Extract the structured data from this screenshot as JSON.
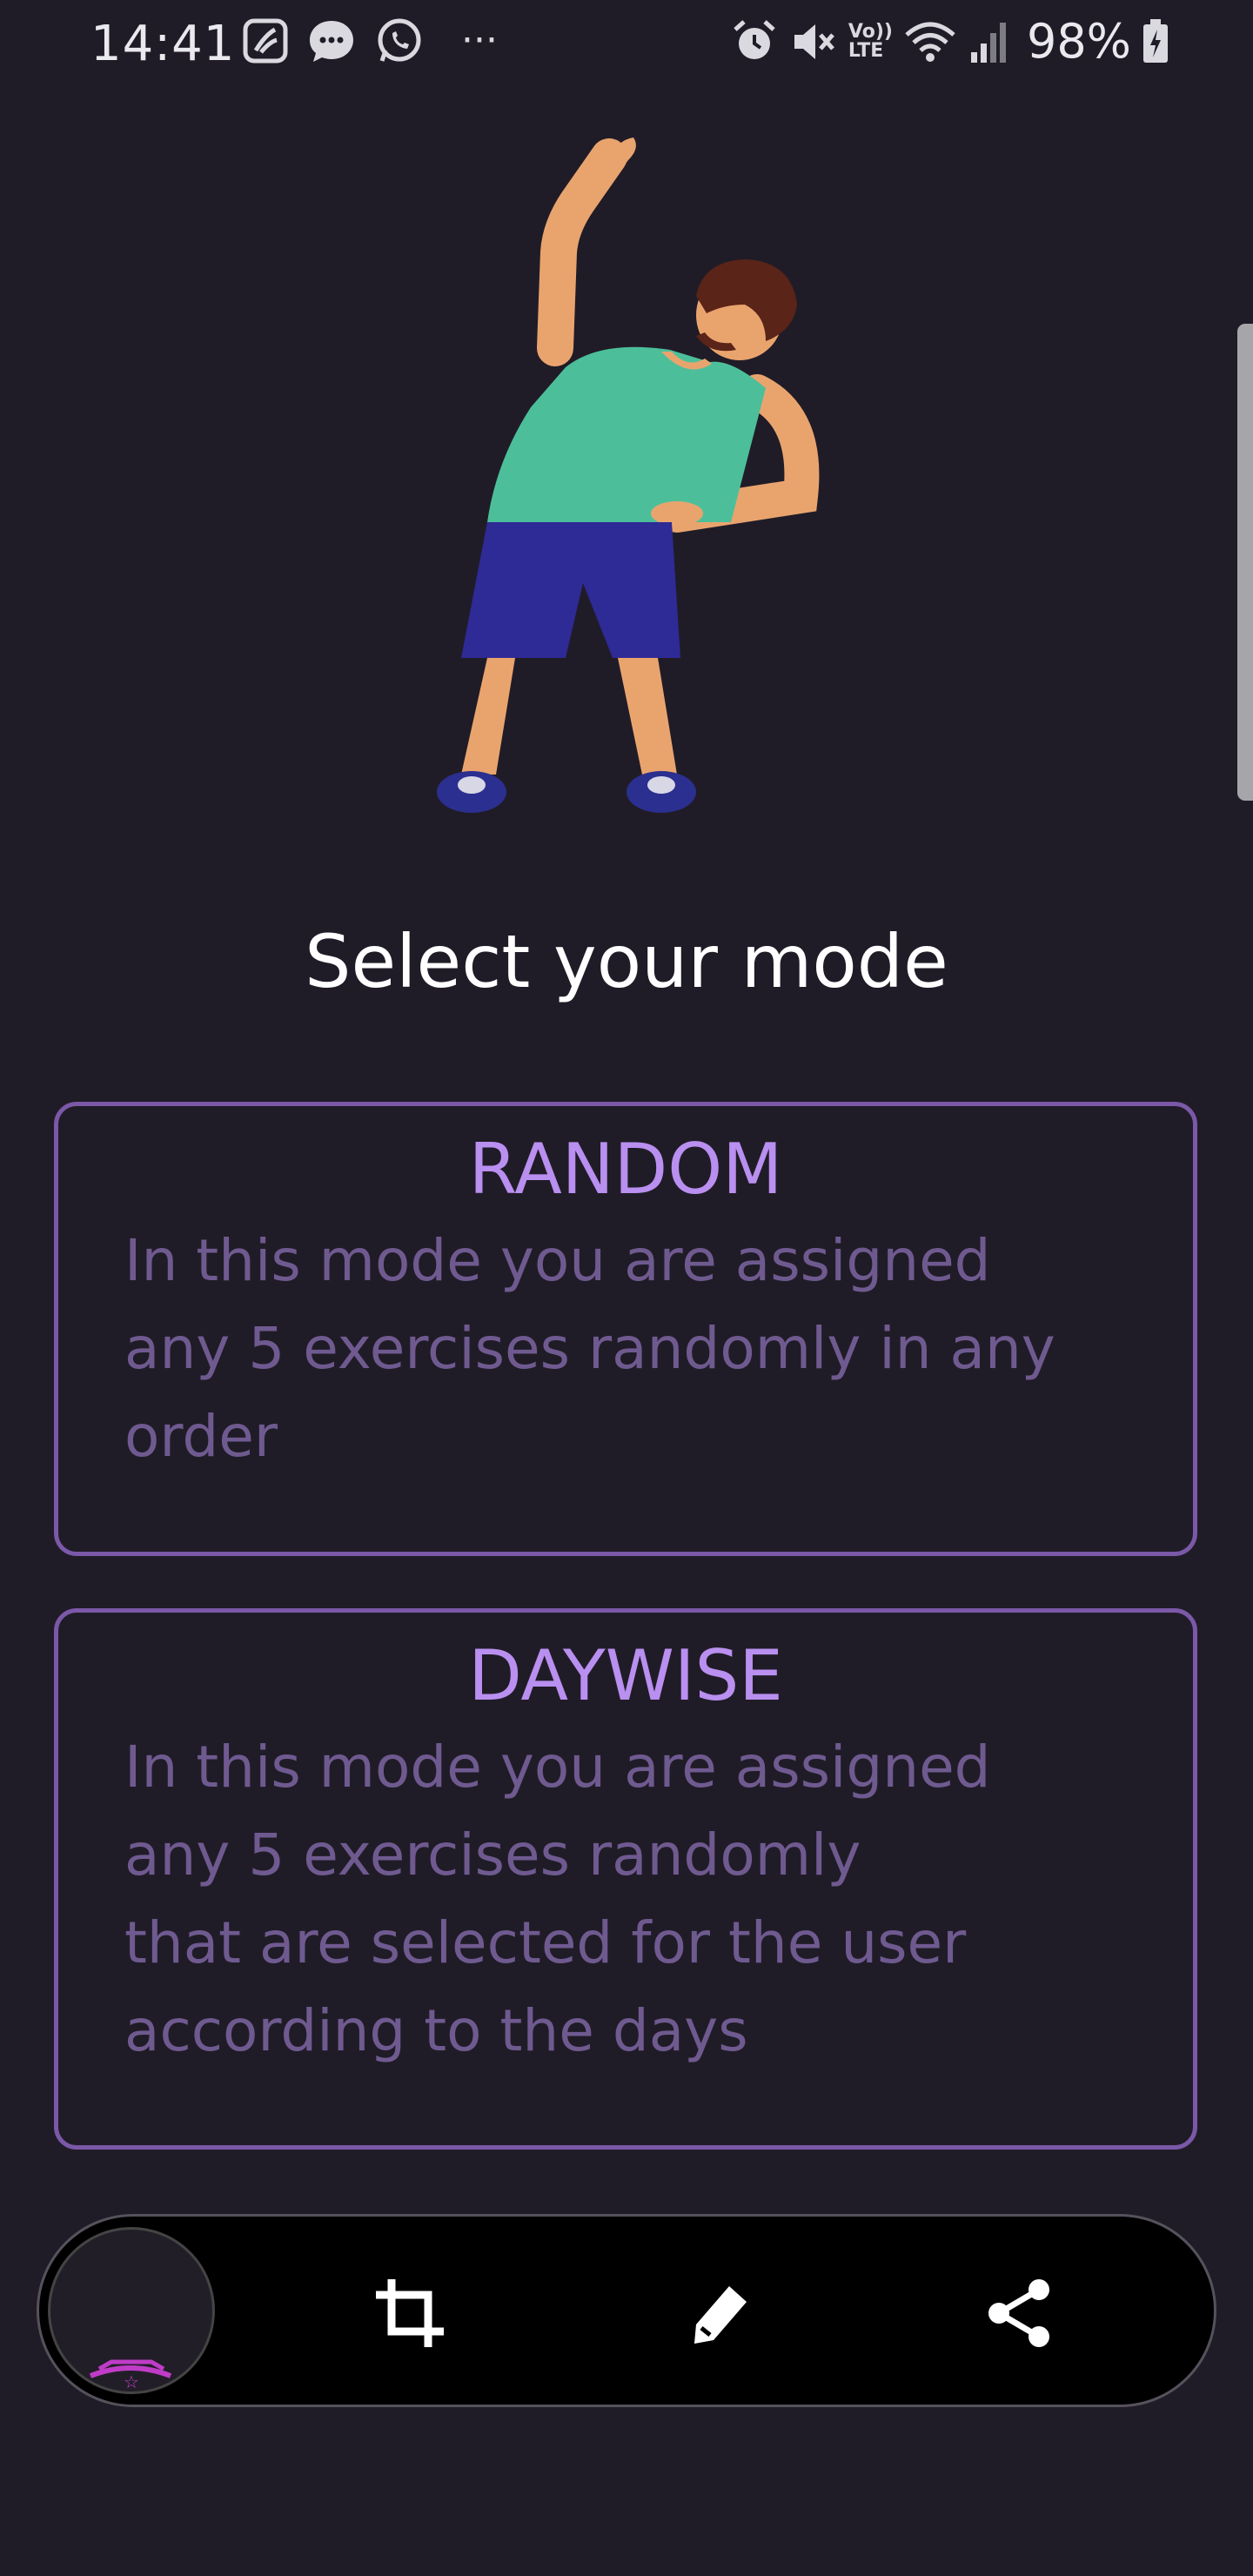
{
  "status_bar": {
    "time": "14:41",
    "battery": "98%",
    "left_icons": [
      "jiosaavn-icon",
      "messages-icon",
      "whatsapp-icon",
      "more-dots-icon"
    ],
    "right_icons": [
      "alarm-icon",
      "mute-icon",
      "volte-icon",
      "wifi-icon",
      "signal-icon",
      "battery-icon"
    ],
    "volte_label_top": "Vo))",
    "volte_label_bottom": "LTE",
    "more": "···"
  },
  "hero": {
    "illustration": "stretching-man-illustration"
  },
  "page": {
    "title": "Select your mode"
  },
  "modes": [
    {
      "title": "RANDOM",
      "description_lines": [
        "In this mode you are assigned",
        "any 5 exercises randomly in any",
        "order"
      ]
    },
    {
      "title": "DAYWISE",
      "description_lines": [
        "In this mode you are assigned",
        "any 5 exercises randomly",
        "that are selected for the user",
        "according to the days"
      ]
    }
  ],
  "toolbar": {
    "items": [
      "screenshot-thumbnail",
      "crop-icon",
      "edit-pen-icon",
      "share-icon"
    ]
  },
  "colors": {
    "background": "#201c27",
    "card_border": "#7b58a8",
    "mode_title": "#b98ff0",
    "mode_description": "#6f5a90",
    "shirt": "#4cbf9a",
    "shorts": "#2e2a96",
    "skin": "#e9a46e"
  }
}
